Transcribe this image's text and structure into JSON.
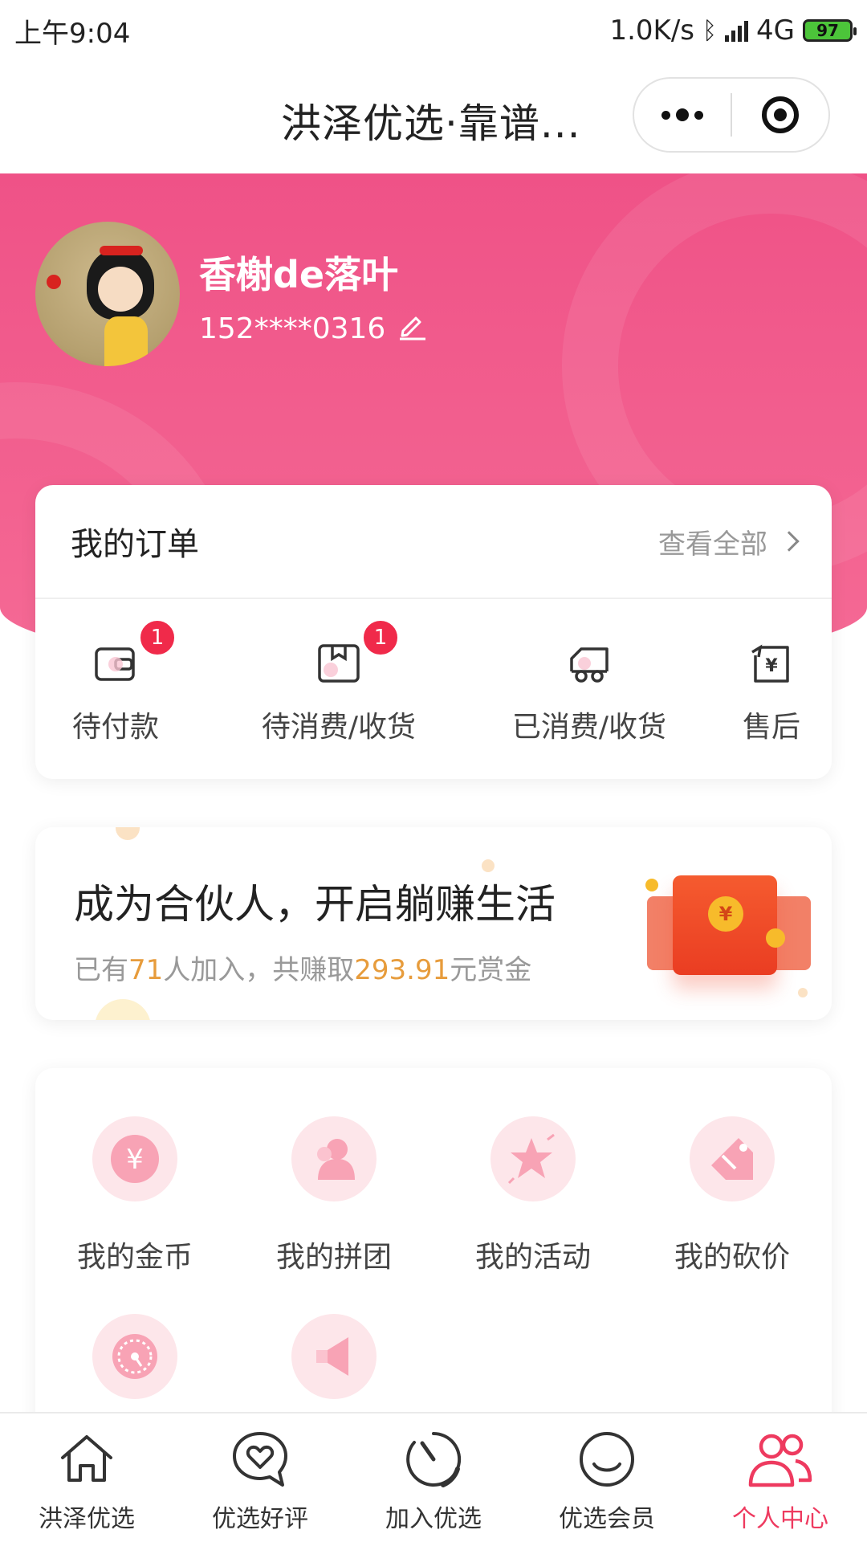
{
  "status_bar": {
    "time": "上午9:04",
    "speed": "1.0K/s",
    "network": "4G",
    "battery": "97"
  },
  "nav": {
    "title": "洪泽优选·靠谱..."
  },
  "user": {
    "name": "香榭de落叶",
    "phone": "152****0316"
  },
  "orders": {
    "title": "我的订单",
    "view_all": "查看全部",
    "items": [
      {
        "label": "待付款",
        "badge": "1",
        "icon": "wallet-icon"
      },
      {
        "label": "待消费/收货",
        "badge": "1",
        "icon": "box-icon"
      },
      {
        "label": "已消费/收货",
        "badge": "",
        "icon": "truck-icon"
      },
      {
        "label": "售后",
        "badge": "",
        "icon": "refund-icon"
      }
    ]
  },
  "partner": {
    "title": "成为合伙人，开启躺赚生活",
    "prefix": "已有",
    "count": "71",
    "mid": "人加入，共赚取",
    "amount": "293.91",
    "suffix": "元赏金"
  },
  "tools": [
    {
      "label": "我的金币",
      "icon": "coin-icon"
    },
    {
      "label": "我的拼团",
      "icon": "group-icon"
    },
    {
      "label": "我的活动",
      "icon": "star-icon"
    },
    {
      "label": "我的砍价",
      "icon": "tag-icon"
    },
    {
      "label": "",
      "icon": "compass-icon"
    },
    {
      "label": "",
      "icon": "megaphone-icon"
    }
  ],
  "tab_bar": {
    "items": [
      {
        "label": "洪泽优选",
        "icon": "home-icon"
      },
      {
        "label": "优选好评",
        "icon": "heart-chat-icon"
      },
      {
        "label": "加入优选",
        "icon": "timer-icon"
      },
      {
        "label": "优选会员",
        "icon": "smile-icon"
      },
      {
        "label": "个人中心",
        "icon": "user-group-icon"
      }
    ],
    "active_index": 4
  },
  "colors": {
    "brand_pink": "#ef5287",
    "badge_red": "#f02a4a",
    "highlight_orange": "#e79c3c",
    "tab_active": "#ee3a5f"
  }
}
